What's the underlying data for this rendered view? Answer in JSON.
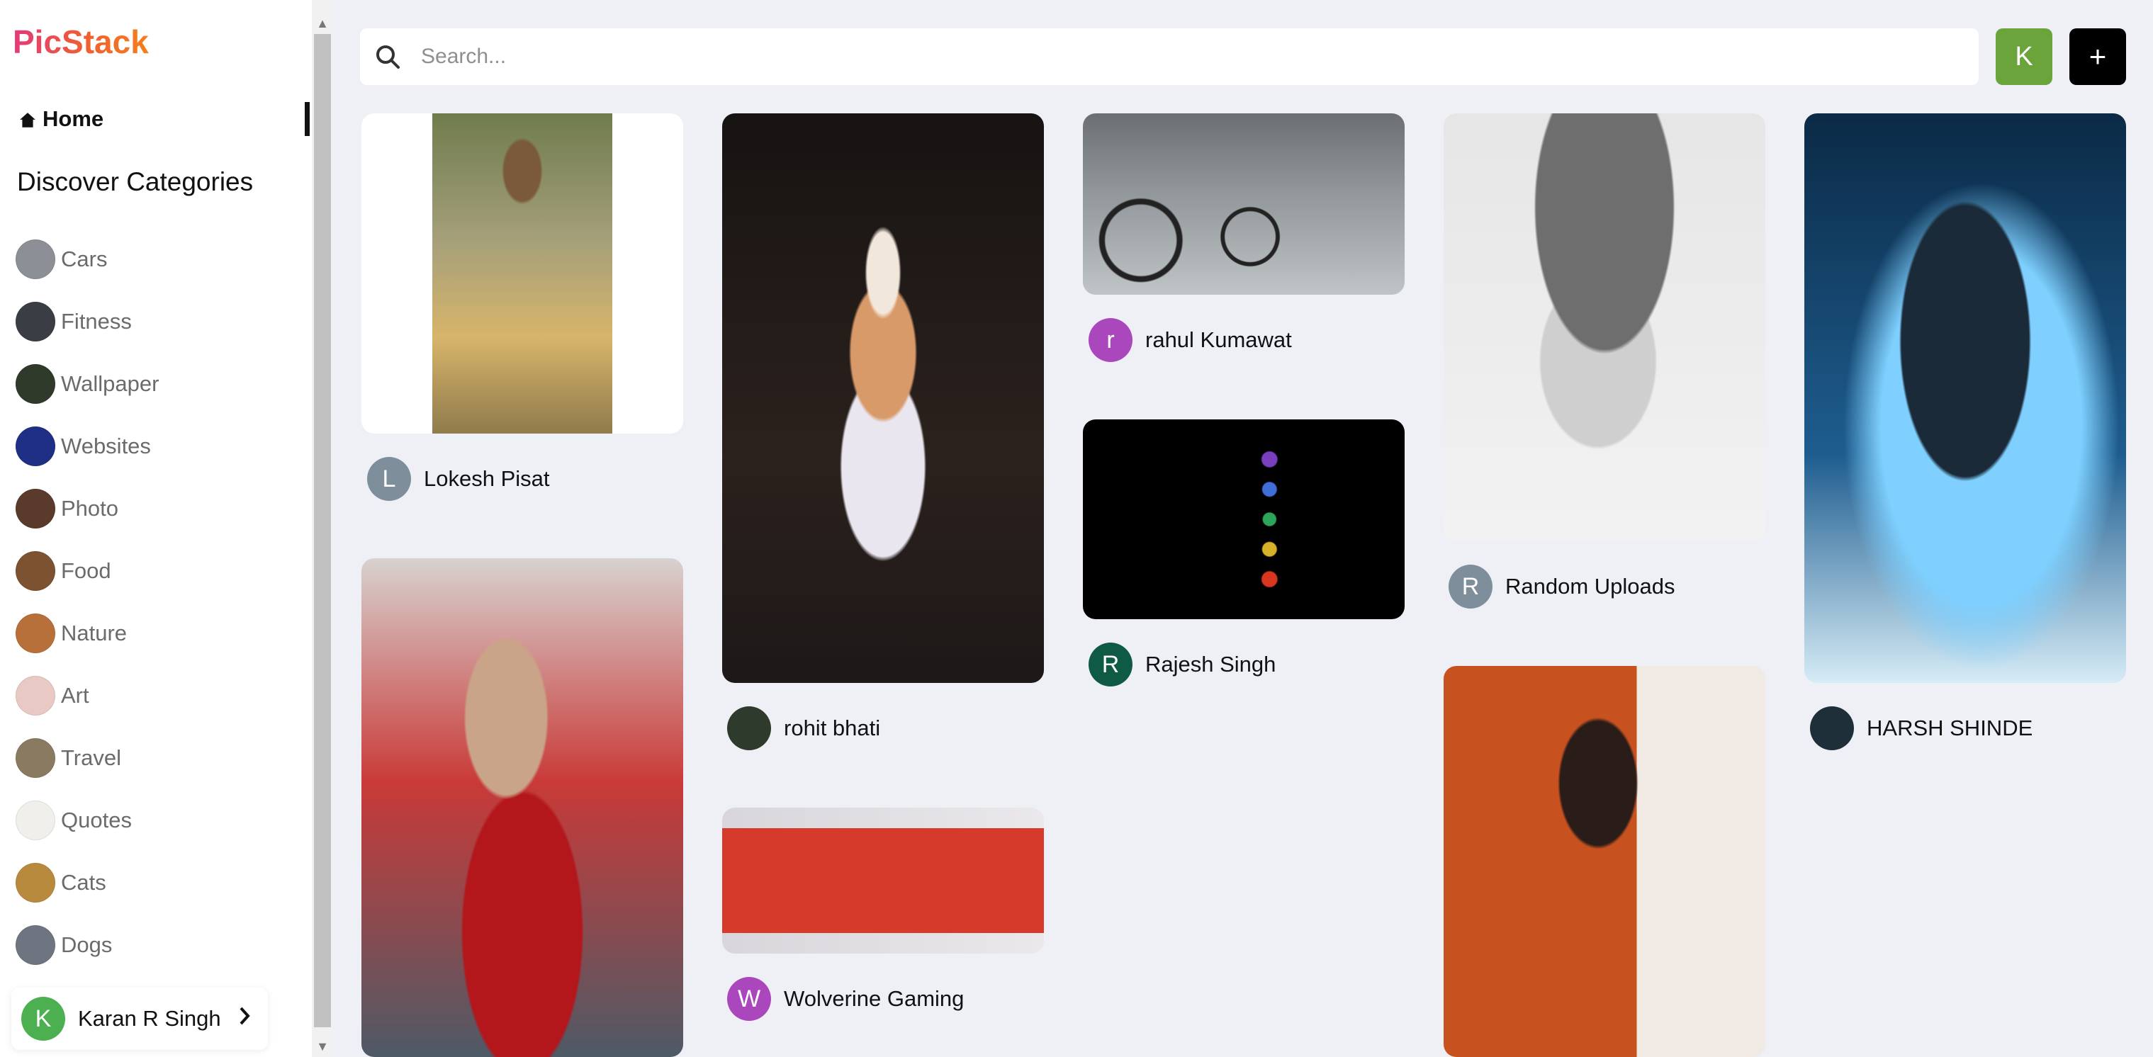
{
  "brand": {
    "name": "PicStack"
  },
  "sidebar": {
    "home_label": "Home",
    "section_title": "Discover Categories",
    "categories": [
      {
        "label": "Cars",
        "color": "#8c8f96"
      },
      {
        "label": "Fitness",
        "color": "#3a3d44"
      },
      {
        "label": "Wallpaper",
        "color": "#2f3a2b"
      },
      {
        "label": "Websites",
        "color": "#1f2f86"
      },
      {
        "label": "Photo",
        "color": "#5a3a2a"
      },
      {
        "label": "Food",
        "color": "#7c5230"
      },
      {
        "label": "Nature",
        "color": "#b7703a"
      },
      {
        "label": "Art",
        "color": "#e8c9c4"
      },
      {
        "label": "Travel",
        "color": "#8b7a62"
      },
      {
        "label": "Quotes",
        "color": "#f1efec"
      },
      {
        "label": "Cats",
        "color": "#b88a3e"
      },
      {
        "label": "Dogs",
        "color": "#6f7580"
      }
    ],
    "user": {
      "initial": "K",
      "name": "Karan R Singh"
    }
  },
  "header": {
    "search_placeholder": "Search...",
    "profile_initial": "K",
    "add_label": "+"
  },
  "pins": [
    {
      "user": "Lokesh Pisat",
      "initial": "L",
      "avatar_color": "#7e8e9a"
    },
    {
      "user": "rohit bhati",
      "initial": "",
      "avatar_color": "#2d3a2c"
    },
    {
      "user": "Wolverine Gaming",
      "initial": "W",
      "avatar_color": "#ab47bc"
    },
    {
      "user": "rahul Kumawat",
      "initial": "r",
      "avatar_color": "#ab47bc"
    },
    {
      "user": "Rajesh Singh",
      "initial": "R",
      "avatar_color": "#0f5a45"
    },
    {
      "user": "Random Uploads",
      "initial": "R",
      "avatar_color": "#7e8e9a"
    },
    {
      "user": "HARSH SHINDE",
      "initial": "",
      "avatar_color": "#1e2f3a"
    }
  ]
}
